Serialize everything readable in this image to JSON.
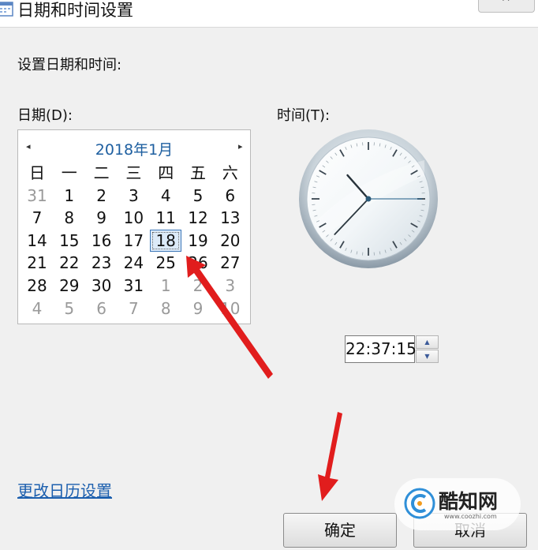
{
  "window": {
    "title": "日期和时间设置",
    "close_glyph": "✕",
    "icon": "calendar-icon"
  },
  "instruction": "设置日期和时间:",
  "date_label": "日期(D):",
  "time_label": "时间(T):",
  "calendar": {
    "month_title": "2018年1月",
    "prev_glyph": "◂",
    "next_glyph": "▸",
    "weekdays": [
      "日",
      "一",
      "二",
      "三",
      "四",
      "五",
      "六"
    ],
    "weeks": [
      [
        "31",
        "1",
        "2",
        "3",
        "4",
        "5",
        "6"
      ],
      [
        "7",
        "8",
        "9",
        "10",
        "11",
        "12",
        "13"
      ],
      [
        "14",
        "15",
        "16",
        "17",
        "18",
        "19",
        "20"
      ],
      [
        "21",
        "22",
        "23",
        "24",
        "25",
        "26",
        "27"
      ],
      [
        "28",
        "29",
        "30",
        "31",
        "1",
        "2",
        "3"
      ],
      [
        "4",
        "5",
        "6",
        "7",
        "8",
        "9",
        "10"
      ]
    ],
    "selected_day": "18"
  },
  "clock": {
    "hour": 22,
    "minute": 37,
    "second": 15
  },
  "time_value": "22:37:15",
  "change_calendar_link": "更改日历设置",
  "buttons": {
    "ok": "确定",
    "cancel": "取消"
  },
  "watermark": {
    "name": "酷知网",
    "url": "www.coozhi.com"
  },
  "colors": {
    "accent": "#1e5fa0",
    "link": "#1c5fae",
    "annotation_arrow": "#e11d1d"
  }
}
